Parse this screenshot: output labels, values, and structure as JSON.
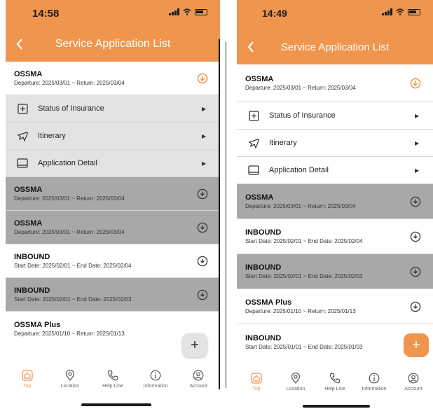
{
  "colors": {
    "accent": "#f0954d",
    "highlight_grey": "#a8a8a8",
    "sub_row_grey": "#e3e3e3"
  },
  "left": {
    "time": "14:58",
    "title": "Service Application List",
    "items": [
      {
        "name": "OSSMA",
        "dates": "Departure: 2025/03/01 ~ Return: 2025/03/04"
      },
      {
        "name": "OSSMA",
        "dates": "Departure: 2025/03/01 ~ Return: 2025/03/04"
      },
      {
        "name": "OSSMA",
        "dates": "Departure: 2025/03/01 ~ Return: 2025/03/04"
      },
      {
        "name": "INBOUND",
        "dates": "Start Date: 2025/02/01 ~ End Date: 2025/02/04"
      },
      {
        "name": "INBOUND",
        "dates": "Start Date: 2025/02/01 ~ End Date: 2025/02/03"
      },
      {
        "name": "OSSMA Plus",
        "dates": "Departure: 2025/01/10 ~ Return: 2025/01/13"
      }
    ],
    "sub_items": [
      {
        "label": "Status of Insurance",
        "icon": "plus-square-icon"
      },
      {
        "label": "Itinerary",
        "icon": "airplane-icon"
      },
      {
        "label": "Application Detail",
        "icon": "tablet-icon"
      }
    ],
    "fab": "+",
    "tabs": [
      "Top",
      "Location",
      "Help Line",
      "Information",
      "Account"
    ]
  },
  "right": {
    "time": "14:49",
    "title": "Service Application List",
    "items": [
      {
        "name": "OSSMA",
        "dates": "Departure: 2025/03/01 ~ Return: 2025/03/04"
      },
      {
        "name": "OSSMA",
        "dates": "Departure: 2025/03/01 ~ Return: 2025/03/04"
      },
      {
        "name": "INBOUND",
        "dates": "Start Date: 2025/02/01 ~ End Date: 2025/02/04"
      },
      {
        "name": "INBOUND",
        "dates": "Start Date: 2025/02/01 ~ End Date: 2025/02/03"
      },
      {
        "name": "OSSMA Plus",
        "dates": "Departure: 2025/01/10 ~ Return: 2025/01/13"
      },
      {
        "name": "INBOUND",
        "dates": "Start Date: 2025/01/01 ~ End Date: 2025/01/03"
      }
    ],
    "sub_items": [
      {
        "label": "Status of Insurance",
        "icon": "plus-square-icon"
      },
      {
        "label": "Itinerary",
        "icon": "airplane-icon"
      },
      {
        "label": "Application Detail",
        "icon": "tablet-icon"
      }
    ],
    "fab": "+",
    "tabs": [
      "Top",
      "Location",
      "Help Line",
      "Information",
      "Account"
    ]
  }
}
